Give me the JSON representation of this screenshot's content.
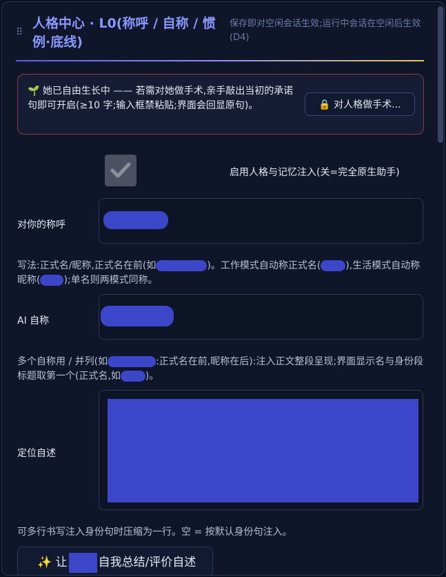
{
  "header": {
    "drag_icon": "⠿",
    "title": "人格中心 · L0(称呼 / 自称 / 惯例·底线)",
    "subtitle": "保存即对空闲会话生效;运行中会话在空闲后生效(D4)"
  },
  "notice": {
    "icon": "🌱",
    "text": "她已自由生长中 —— 若需对她做手术,亲手敲出当初的承诺句即可开启(≥10 字;输入框禁粘贴;界面会回显原句)。",
    "button_icon": "🔒",
    "button_label": "对人格做手术..."
  },
  "toggle": {
    "checked": true,
    "label": "启用人格与记忆注入(关=完全原生助手)"
  },
  "fields": {
    "address_label": "对你的称呼",
    "address_hint_1": "写法:正式名/昵称,正式名在前(如",
    "address_hint_2": ")。工作模式自动称正式名(",
    "address_hint_3": "),生活模式自动称昵称(",
    "address_hint_4": ");单名则两模式同称。",
    "self_label": "AI 自称",
    "self_hint_1": "多个自称用 / 并列(如",
    "self_hint_2": ":正式名在前,昵称在后):注入正文整段呈现;界面显示名与身份段标题取第一个(正式名,如",
    "self_hint_3": ")。",
    "position_label": "定位自述",
    "position_hint": "可多行书写注入身份句时压缩为一行。空 = 按默认身份句注入。"
  },
  "action": {
    "icon": "✨",
    "prefix": "让",
    "suffix": "自我总结/评价自述"
  },
  "colors": {
    "accent": "#8b98ff",
    "redaction": "#3b47c8",
    "alert_border": "#8a3a47"
  }
}
